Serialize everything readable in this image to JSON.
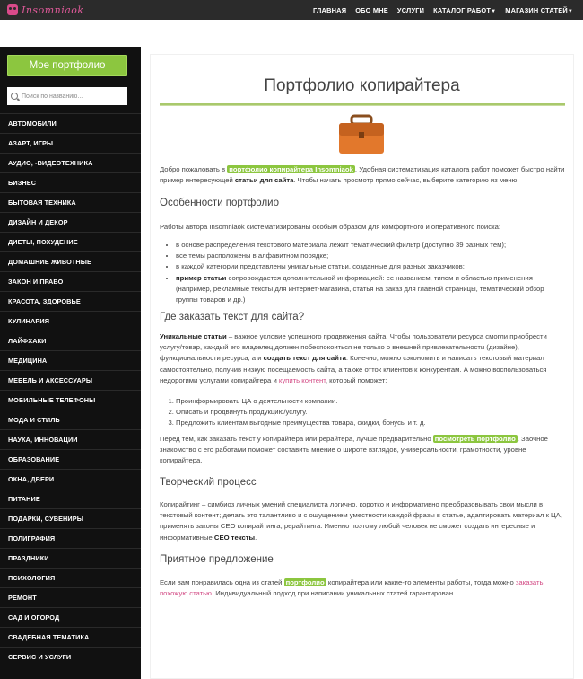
{
  "header": {
    "logo_text": "Insomniaok",
    "nav": [
      {
        "label": "ГЛАВНАЯ"
      },
      {
        "label": "ОБО МНЕ"
      },
      {
        "label": "УСЛУГИ"
      },
      {
        "label": "КАТАЛОГ РАБОТ",
        "has_dropdown": true
      },
      {
        "label": "МАГАЗИН СТАТЕЙ",
        "has_dropdown": true
      }
    ]
  },
  "sidebar": {
    "portfolio_button": "Мое портфолио",
    "search_placeholder": "Поиск по названию...",
    "categories": [
      "АВТОМОБИЛИ",
      "АЗАРТ, ИГРЫ",
      "АУДИО, -ВИДЕОТЕХНИКА",
      "БИЗНЕС",
      "БЫТОВАЯ ТЕХНИКА",
      "ДИЗАЙН И ДЕКОР",
      "ДИЕТЫ, ПОХУДЕНИЕ",
      "ДОМАШНИЕ ЖИВОТНЫЕ",
      "ЗАКОН И ПРАВО",
      "КРАСОТА, ЗДОРОВЬЕ",
      "КУЛИНАРИЯ",
      "ЛАЙФХАКИ",
      "МЕДИЦИНА",
      "МЕБЕЛЬ И АКСЕССУАРЫ",
      "МОБИЛЬНЫЕ ТЕЛЕФОНЫ",
      "МОДА И СТИЛЬ",
      "НАУКА, ИННОВАЦИИ",
      "ОБРАЗОВАНИЕ",
      "ОКНА, ДВЕРИ",
      "ПИТАНИЕ",
      "ПОДАРКИ, СУВЕНИРЫ",
      "ПОЛИГРАФИЯ",
      "ПРАЗДНИКИ",
      "ПСИХОЛОГИЯ",
      "РЕМОНТ",
      "САД И ОГОРОД",
      "СВАДЕБНАЯ ТЕМАТИКА",
      "СЕРВИС И УСЛУГИ"
    ]
  },
  "main": {
    "title": "Портфолио копирайтера",
    "intro": {
      "t1": "Добро пожаловать в ",
      "hl": "портфолио копирайтера Insomniaok",
      "t2": ". Удобная систематизация каталога работ поможет быстро найти пример интересующей ",
      "b": "статьи для сайта",
      "t3": ". Чтобы начать просмотр прямо сейчас, выберите категорию из меню."
    },
    "features_heading": "Особенности портфолио",
    "features_intro": "Работы автора Insomniaok систематизированы особым образом для комфортного и оперативного поиска:",
    "features": [
      "в основе распределения текстового материала лежит тематический фильтр (доступно 39 разных тем);",
      "все темы расположены в алфавитном порядке;",
      "в каждой категории представлены уникальные статьи, созданные для разных заказчиков;"
    ],
    "feature4_b": "пример статьи",
    "feature4_t": " сопровождается дополнительной информацией: ее названием, типом и областью применения (например, рекламные тексты для интернет-магазина, статья на заказ для главной страницы, тематический обзор группы товаров и др.)",
    "order_heading": "Где заказать текст для сайта?",
    "order": {
      "b1": "Уникальные статьи",
      "t1": " – важное условие успешного продвижения сайта. Чтобы пользователи ресурса смогли приобрести услугу/товар, каждый его владелец должен побеспокоиться не только о внешней привлекательности (дизайне), функциональности ресурса, а и ",
      "b2": "создать текст для сайта",
      "t2": ". Конечно, можно сэкономить и написать текстовый материал самостоятельно, получив низкую посещаемость сайта, а также отток клиентов к конкурентам. А можно воспользоваться недорогими услугами копирайтера и ",
      "link": "купить контент",
      "t3": ", который поможет:"
    },
    "order_list": [
      "Проинформировать ЦА о деятельности компании.",
      "Описать и продвинуть продукцию/услугу.",
      "Предложить клиентам выгодные преимущества товара, скидки, бонусы и т. д."
    ],
    "before": {
      "t1": "Перед тем, как заказать текст у копирайтера или рерайтера, лучше предварительно ",
      "hl": "посмотреть портфолио",
      "t2": ". Заочное знакомство с его работами поможет составить мнение о широте взглядов, универсальности, грамотности, уровне копирайтера."
    },
    "process_heading": "Творческий процесс",
    "process": {
      "t1": "Копирайтинг – симбиоз личных умений специалиста логично, коротко и информативно преобразовывать свои мысли в текстовый контент; делать это талантливо и с ощущением уместности каждой фразы в статье, адаптировать материал к ЦА, применять законы СЕО копирайтинга, рерайтинга. Именно поэтому любой человек не сможет создать интересные и информативные ",
      "b": "СЕО тексты",
      "t2": "."
    },
    "offer_heading": "Приятное предложение",
    "offer": {
      "t1": "Если вам понравилась одна из статей ",
      "hl": "портфолио",
      "t2": " копирайтера или какие-то элементы работы, тогда можно ",
      "link": "заказать похожую статью",
      "t3": ". Индивидуальный подход при написании уникальных статей гарантирован."
    }
  },
  "colors": {
    "accent_green": "#8cc63f",
    "link_pink": "#d24a84",
    "sidebar_bg": "#111111",
    "topbar_bg": "#2b2b2b"
  }
}
